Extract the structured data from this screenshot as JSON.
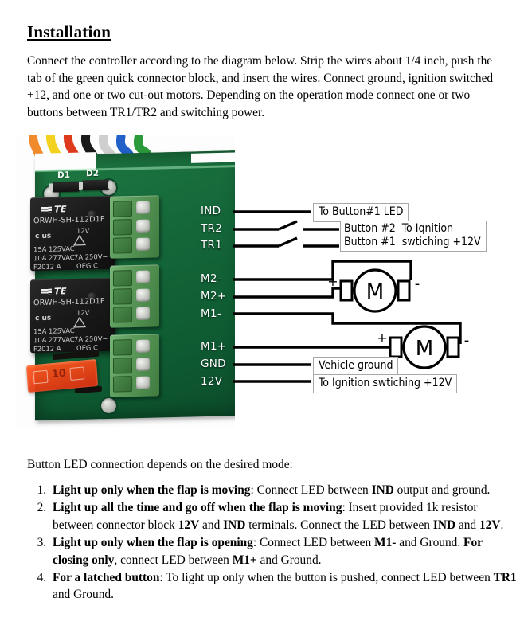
{
  "document": {
    "heading": "Installation",
    "intro": "Connect the controller according to the diagram below. Strip the wires about 1/4 inch, push the tab of the green quick connector block, and insert the wires. Connect ground, ignition switched +12, and one or two cut-out motors. Depending on the operation mode connect one or two buttons between TR1/TR2 and switching power.",
    "lead": "Button LED connection depends on the desired mode:",
    "modes": [
      {
        "bold_lead": "Light up only when the flap is moving",
        "rest_1": ": Connect LED between ",
        "bold_2": "IND",
        "rest_2": " output and ground.",
        "bold_3": "",
        "rest_3": "",
        "bold_4": "",
        "rest_4": ""
      },
      {
        "bold_lead": "Light up all the time and go off when the flap is moving",
        "rest_1": ": Insert provided 1k resistor between connector block ",
        "bold_2": "12V",
        "rest_2": " and ",
        "bold_3": "IND",
        "rest_3": " terminals. Connect the LED between ",
        "bold_4": "IND",
        "rest_4": " and "
      },
      {
        "bold_lead": "Light up only when the flap is opening",
        "rest_1": ": Connect LED between ",
        "bold_2": "M1-",
        "rest_2": " and Ground. ",
        "bold_3": "For closing only",
        "rest_3": ", connect LED between ",
        "bold_4": "M1+",
        "rest_4": " and Ground."
      },
      {
        "bold_lead": "For a latched button",
        "rest_1": ": To light up only when the button is pushed, connect LED between ",
        "bold_2": "TR1",
        "rest_2": " and Ground.",
        "bold_3": "",
        "rest_3": "",
        "bold_4": "",
        "rest_4": ""
      }
    ],
    "mode2_tail_bold": "12V",
    "mode2_tail_rest": "."
  },
  "diagram": {
    "board": {
      "silkscreen": {
        "d1": "D1",
        "d2": "D2"
      },
      "relay": {
        "brand": "TE",
        "part_number": "ORWH-SH-112D1F",
        "coil_voltage": "12V",
        "agency": "c    us",
        "rating_1": "15A 125VAC",
        "rating_2": "10A 277VAC",
        "rating_3": "F2012  A",
        "rating_4": "7A  250V~",
        "rating_5": "OEG   C"
      },
      "fuse": {
        "rating": "10"
      },
      "wire_colors": [
        "#f08a2a",
        "#f2d21e",
        "#e03a1c",
        "#1a1a1a",
        "#cfcfcf",
        "#2060c8",
        "#2a9a3a"
      ]
    },
    "terminals": [
      {
        "name": "IND"
      },
      {
        "name": "TR2"
      },
      {
        "name": "TR1"
      },
      {
        "name": "M2-"
      },
      {
        "name": "M2+"
      },
      {
        "name": "M1-"
      },
      {
        "name": "M1+"
      },
      {
        "name": "GND"
      },
      {
        "name": "12V"
      }
    ],
    "callouts": {
      "ind": "To Button#1 LED",
      "button2": "Button #2",
      "button1": "Button #1",
      "ignition_switched": "To Iqnition\nswtiching +12V",
      "ignition_line1": "To Iqnition",
      "ignition_line2": "swtiching +12V",
      "ground": "Vehicle ground",
      "power": "To Ignition swtiching +12V"
    },
    "motors": [
      {
        "label": "M",
        "positive": "+",
        "negative": "-"
      },
      {
        "label": "M",
        "positive": "+",
        "negative": "-"
      }
    ]
  }
}
